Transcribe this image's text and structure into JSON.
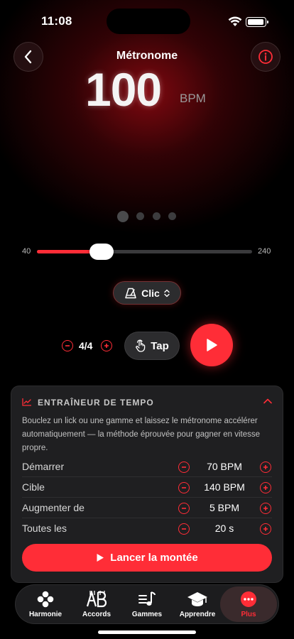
{
  "status_bar": {
    "time": "11:08"
  },
  "header": {
    "title": "Métronome"
  },
  "tempo": {
    "value": "100",
    "unit": "BPM"
  },
  "pager": {
    "count": 4,
    "active_index": 0
  },
  "slider": {
    "min_label": "40",
    "max_label": "240",
    "min": 40,
    "max": 240,
    "value": 100
  },
  "sound": {
    "label": "Clic"
  },
  "controls": {
    "time_signature": "4/4",
    "tap_label": "Tap"
  },
  "trainer": {
    "title": "ENTRAÎNEUR DE TEMPO",
    "description": "Bouclez un lick ou une gamme et laissez le métronome accélérer automatiquement — la méthode éprouvée pour gagner en vitesse propre.",
    "rows": [
      {
        "label": "Démarrer",
        "value": "70 BPM"
      },
      {
        "label": "Cible",
        "value": "140 BPM"
      },
      {
        "label": "Augmenter de",
        "value": "5 BPM"
      },
      {
        "label": "Toutes les",
        "value": "20 s"
      }
    ],
    "launch_label": "Lancer la montée"
  },
  "tabs": [
    {
      "label": "Harmonie",
      "icon": "harmony-icon"
    },
    {
      "label": "Accords",
      "icon": "chords-icon"
    },
    {
      "label": "Gammes",
      "icon": "scales-icon"
    },
    {
      "label": "Apprendre",
      "icon": "graduation-cap-icon"
    },
    {
      "label": "Plus",
      "icon": "more-icon",
      "active": true
    }
  ],
  "colors": {
    "accent": "#ff2d37",
    "card": "#1f1f21",
    "background": "#000000"
  }
}
